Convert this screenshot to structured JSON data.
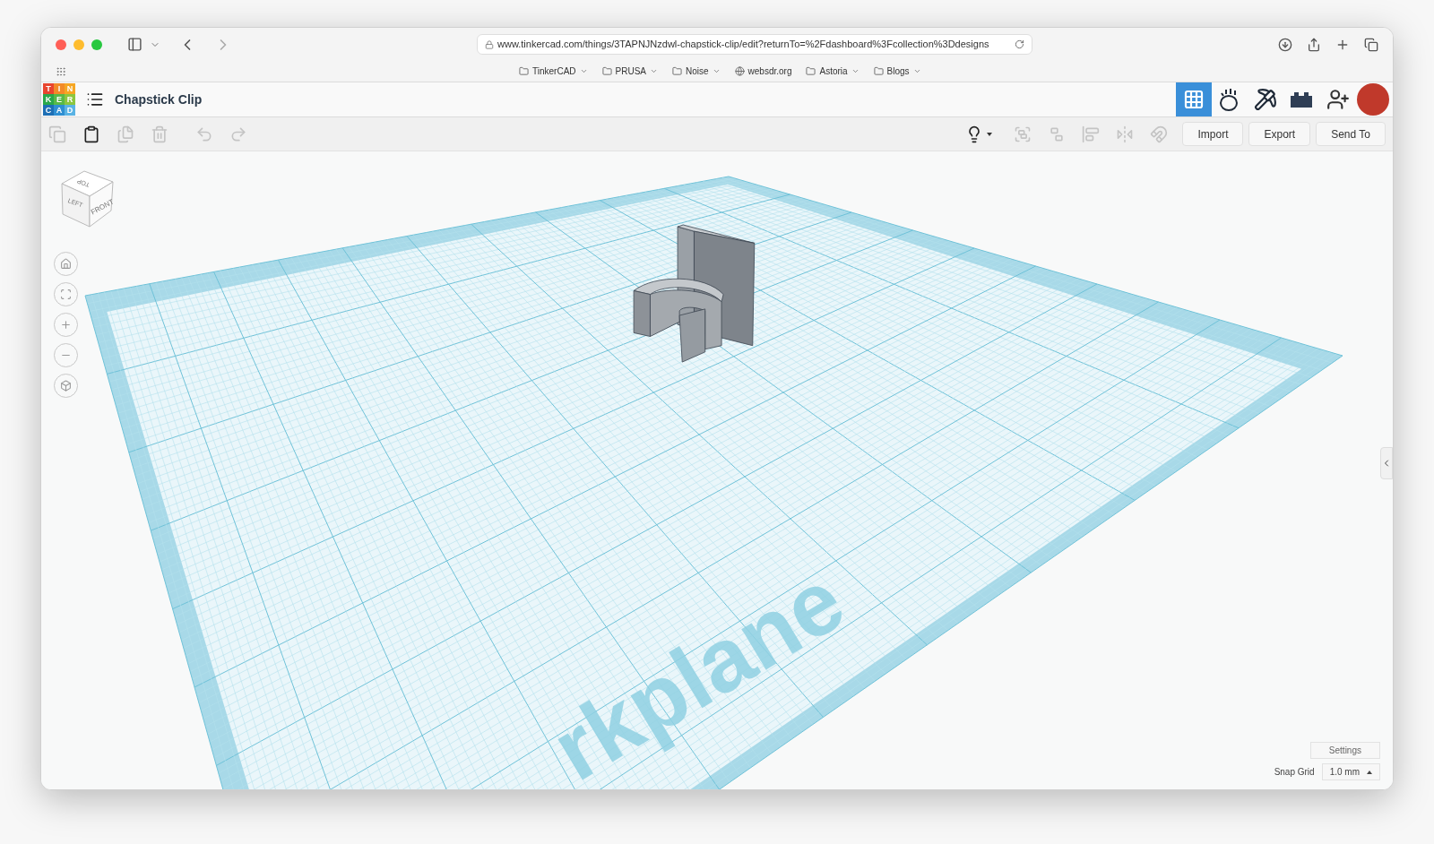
{
  "browser": {
    "url": "www.tinkercad.com/things/3TAPNJNzdwl-chapstick-clip/edit?returnTo=%2Fdashboard%3Fcollection%3Ddesigns",
    "bookmarks": [
      {
        "kind": "folder",
        "label": "TinkerCAD"
      },
      {
        "kind": "folder",
        "label": "PRUSA"
      },
      {
        "kind": "folder",
        "label": "Noise"
      },
      {
        "kind": "site",
        "label": "websdr.org"
      },
      {
        "kind": "folder",
        "label": "Astoria"
      },
      {
        "kind": "folder",
        "label": "Blogs"
      }
    ]
  },
  "app": {
    "logo": [
      {
        "letter": "T",
        "color": "#e8452f"
      },
      {
        "letter": "I",
        "color": "#f28a27"
      },
      {
        "letter": "N",
        "color": "#f5a623"
      },
      {
        "letter": "K",
        "color": "#2aa84a"
      },
      {
        "letter": "E",
        "color": "#58b947"
      },
      {
        "letter": "R",
        "color": "#8cc63f"
      },
      {
        "letter": "C",
        "color": "#1e6fb5"
      },
      {
        "letter": "A",
        "color": "#2f8fd2"
      },
      {
        "letter": "D",
        "color": "#5ab3e4"
      }
    ],
    "title": "Chapstick Clip",
    "view_tabs": [
      {
        "kind": "grid",
        "selected": true
      },
      {
        "kind": "blob",
        "selected": false
      },
      {
        "kind": "pickaxe",
        "selected": false
      },
      {
        "kind": "brick",
        "selected": false
      }
    ]
  },
  "toolbar": {
    "edit_tools": [
      {
        "kind": "copy",
        "disabled": true
      },
      {
        "kind": "paste",
        "disabled": false
      },
      {
        "kind": "duplicate",
        "disabled": true
      },
      {
        "kind": "delete",
        "disabled": true
      },
      {
        "kind": "undo",
        "disabled": true
      },
      {
        "kind": "redo",
        "disabled": true
      }
    ],
    "shape_tools": [
      {
        "kind": "group",
        "disabled": true
      },
      {
        "kind": "ungroup",
        "disabled": true
      },
      {
        "kind": "align",
        "disabled": true
      },
      {
        "kind": "mirror",
        "disabled": true
      },
      {
        "kind": "magnet",
        "disabled": true
      }
    ],
    "buttons": [
      "Import",
      "Export",
      "Send To"
    ]
  },
  "view_cube": {
    "faces": [
      "TOP",
      "LEFT",
      "FRONT"
    ]
  },
  "view_controls": [
    {
      "kind": "home"
    },
    {
      "kind": "fit"
    },
    {
      "kind": "zoom_in"
    },
    {
      "kind": "zoom_out"
    },
    {
      "kind": "perspective"
    }
  ],
  "workplane_label": "rkplane",
  "footer": {
    "settings": "Settings",
    "snap_grid": {
      "label": "Snap Grid",
      "value": "1.0 mm"
    }
  }
}
